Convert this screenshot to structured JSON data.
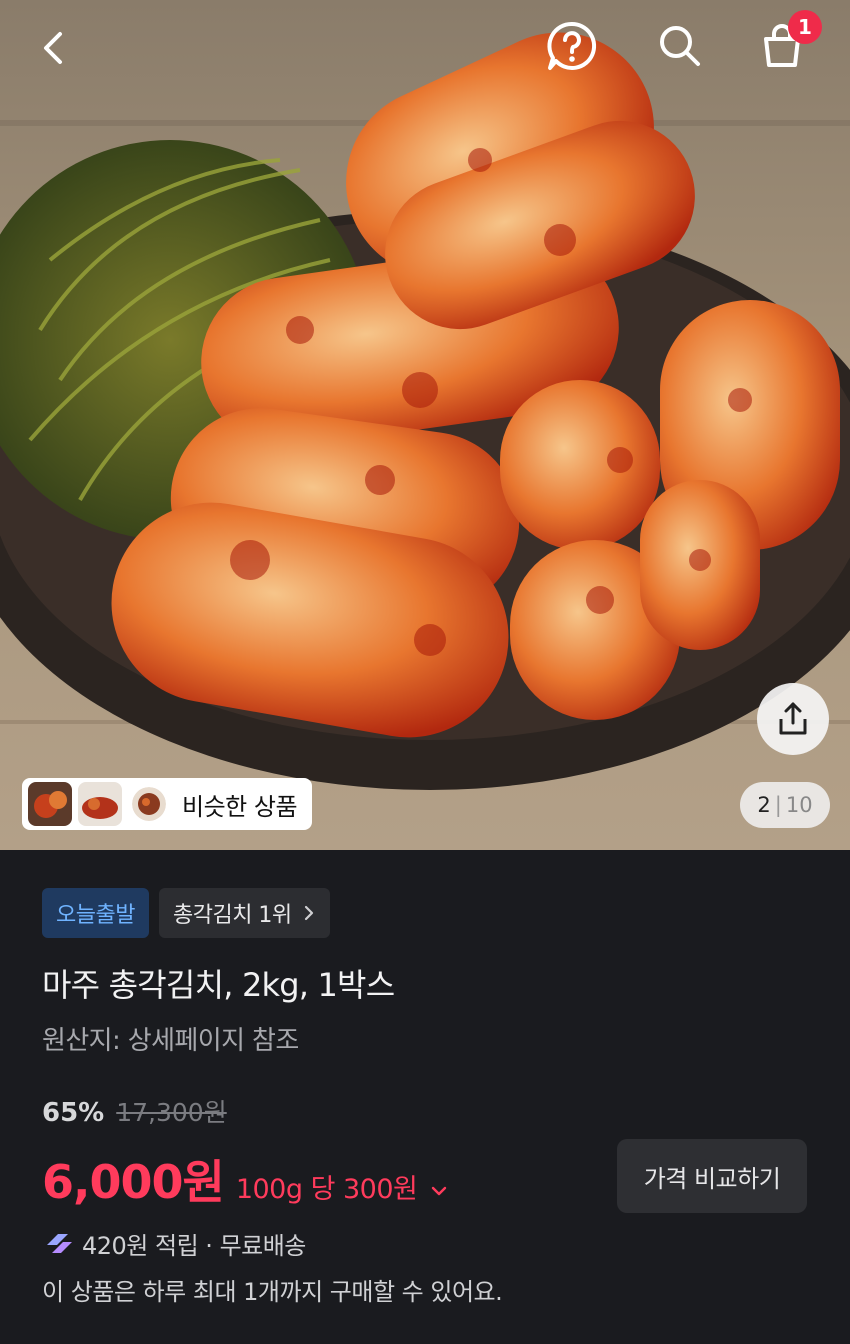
{
  "header": {
    "cart_count": "1",
    "icons": {
      "back": "chevron-left-icon",
      "help": "question-bubble-icon",
      "search": "search-icon",
      "cart": "shopping-bag-icon"
    }
  },
  "gallery": {
    "current": "2",
    "separator": "|",
    "total": "10",
    "similar_label": "비슷한 상품",
    "share_icon": "share-icon"
  },
  "product": {
    "delivery_badge": "오늘출발",
    "rank_badge": "총각김치 1위",
    "title": "마주 총각김치, 2kg, 1박스",
    "origin": "원산지: 상세페이지 참조",
    "discount": "65%",
    "original_price": "17,300원",
    "price": "6,000원",
    "unit_price": "100g 당 300원",
    "compare_label": "가격 비교하기",
    "reward_text": "420원 적립 · 무료배송",
    "limit_note": "이 상품은 하루 최대 1개까지 구매할 수 있어요."
  },
  "colors": {
    "accent_red": "#ff3b5c",
    "badge_blue_text": "#6fb3ff",
    "badge_blue_bg": "#1f3a60",
    "background": "#1a1b1f"
  }
}
